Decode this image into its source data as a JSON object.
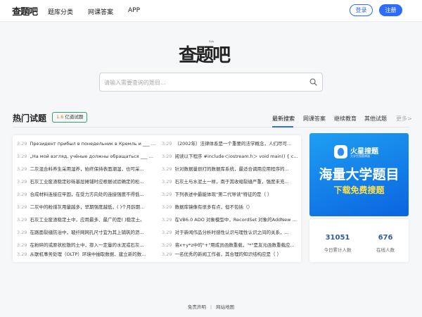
{
  "header": {
    "logo": "查题吧",
    "nav": [
      "题库分类",
      "网课答案",
      "APP"
    ],
    "login_label": "登录",
    "register_label": "注册"
  },
  "brand": {
    "title": "查题吧",
    "tiny": "S/A"
  },
  "search": {
    "placeholder": "请输入需要查询的题目..."
  },
  "section": {
    "title": "热门试题",
    "badge_count": "1.6",
    "badge_text": "亿道试题",
    "tabs": [
      "最新搜索",
      "网课答案",
      "继续教育",
      "其他试题"
    ],
    "more": "更多>"
  },
  "questions_left": [
    {
      "date": "3.29",
      "text": "Президент прибыл в понедельник в Кремль и ___ со..."
    },
    {
      "date": "3.29",
      "text": "„На мой взгляд, учёные должны обращаться ___ на ..."
    },
    {
      "date": "3.29",
      "text": "二灰混合料养生采用湿养，始终保持表面潮湿，也可采..."
    },
    {
      "date": "3.29",
      "text": "石灰工业废渣稳定砂砾基层摊铺时应根据试验确定的松..."
    },
    {
      "date": "3.29",
      "text": "合成材料连接应牢固，在受力方向处的连接强度不得低..."
    },
    {
      "date": "3.29",
      "text": "二灰中的粉煤灰用量越多，早期强度越低，( )个月龄期..."
    },
    {
      "date": "3.29",
      "text": "石灰工业废渣稳定土中，应用最多、最广的是( )稳定土。"
    },
    {
      "date": "3.29",
      "text": "在路面裂缝防治中，玻纤网网孔尺寸宜为其上铺筑的沥..."
    },
    {
      "date": "3.29",
      "text": "在粉碎的或原状松散的土中，掺入一定量的水泥或石灰..."
    },
    {
      "date": "3.29",
      "text": "从联机事务处理（OLTP）环境中抽取数据、建立新的数..."
    }
  ],
  "questions_right": [
    {
      "date": "3.29",
      "text": "（2002年）法律体系是一个重要的法学概念，人们尽可..."
    },
    {
      "date": "3.29",
      "text": "阅读以下程序 #include＜iostream.h＞ void main() { char..."
    },
    {
      "date": "3.29",
      "text": "针对数据量很打的数据库系统，最适合调用应用程序的..."
    },
    {
      "date": "3.29",
      "text": "石灰土与水泥土一样，南于其收缩裂缝严重，强度未充..."
    },
    {
      "date": "3.29",
      "text": "下列表述中最能体现\"第二代导读\"特征的是（ ）"
    },
    {
      "date": "3.29",
      "text": "数据库镜像有很多有点，但不包括（）"
    },
    {
      "date": "3.29",
      "text": "在VB6.0 ADO 对象模型中，RecordSet 对象的AddNew ..."
    },
    {
      "date": "3.29",
      "text": "对于新闻作品分析时感性认识与理性认识之间的关系，..."
    },
    {
      "date": "3.29",
      "text": "将x+y*z中的\"+\"用成员函数重载，\"*\"是友元函数重载应..."
    },
    {
      "date": "3.29",
      "text": "一名优秀的新闻工作者，其合理的知识结构应是（ ）"
    }
  ],
  "promo": {
    "brand": "火星搜题",
    "brand_sub": "大学生搜题神器",
    "title": "海量大学题目",
    "subtitle": "下载免费搜题"
  },
  "stats": [
    {
      "value": "31051",
      "label": "今日累计人数"
    },
    {
      "value": "676",
      "label": "在线人数"
    }
  ],
  "footer": {
    "links": [
      "免责声明",
      "网站地图"
    ],
    "separator": "|"
  },
  "colors": {
    "accent": "#2f6bff",
    "badge_border": "#2fa56b",
    "badge_highlight": "#e8711e",
    "stat_number": "#2e5e9e",
    "promo_yellow": "#ffe14a"
  }
}
